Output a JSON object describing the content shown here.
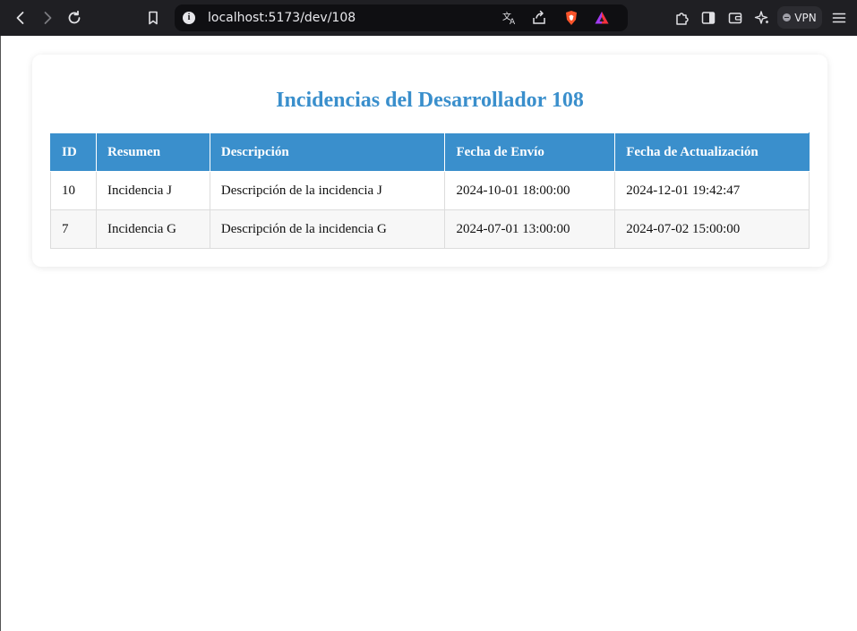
{
  "browser": {
    "url": "localhost:5173/dev/108",
    "vpn_label": "VPN",
    "icons": [
      "back-icon",
      "forward-icon",
      "reload-icon",
      "bookmark-icon",
      "site-info-icon",
      "translate-icon",
      "share-icon",
      "brave-shield-icon",
      "brave-rewards-icon",
      "extensions-icon",
      "sidebar-icon",
      "wallet-icon",
      "leo-ai-icon",
      "vpn-icon",
      "menu-icon"
    ]
  },
  "page": {
    "title": "Incidencias del Desarrollador 108",
    "accent_color": "#3a8fcc"
  },
  "table": {
    "headers": [
      "ID",
      "Resumen",
      "Descripción",
      "Fecha de Envío",
      "Fecha de Actualización"
    ],
    "rows": [
      [
        "10",
        "Incidencia J",
        "Descripción de la incidencia J",
        "2024-10-01 18:00:00",
        "2024-12-01 19:42:47"
      ],
      [
        "7",
        "Incidencia G",
        "Descripción de la incidencia G",
        "2024-07-01 13:00:00",
        "2024-07-02 15:00:00"
      ]
    ]
  }
}
